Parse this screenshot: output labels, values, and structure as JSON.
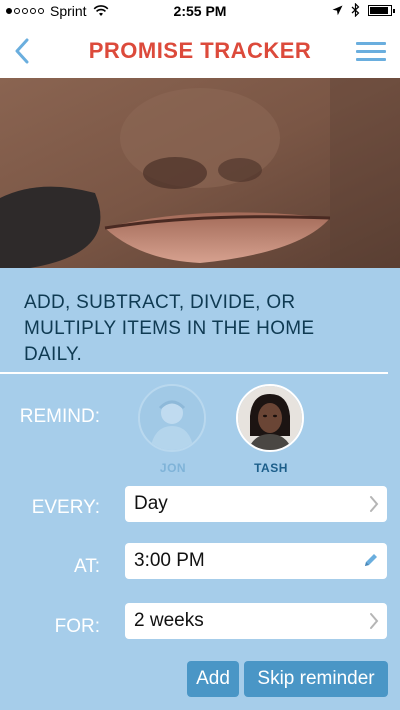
{
  "status_bar": {
    "carrier": "Sprint",
    "time": "2:55 PM"
  },
  "header": {
    "title": "PROMISE TRACKER",
    "title_color": "#dc4a3b",
    "back_icon": "chevron-left-icon",
    "menu_icon": "hamburger-menu-icon"
  },
  "task": {
    "title": "ADD, SUBTRACT, DIVIDE, OR MULTIPLY ITEMS IN THE HOME DAILY."
  },
  "remind": {
    "label": "REMIND:",
    "people": [
      {
        "name": "JON",
        "selected": false
      },
      {
        "name": "TASH",
        "selected": true
      }
    ]
  },
  "every": {
    "label": "EVERY:",
    "value": "Day",
    "icon": "chevron-right-icon"
  },
  "at": {
    "label": "AT:",
    "value": "3:00 PM",
    "icon": "pencil-icon"
  },
  "for": {
    "label": "FOR:",
    "value": "2 weeks",
    "icon": "chevron-right-icon"
  },
  "actions": {
    "add_label": "Add",
    "skip_label": "Skip reminder"
  },
  "colors": {
    "panel_bg": "#a6cdea",
    "button_bg": "#4a96c6",
    "accent_blue": "#6aaede"
  }
}
